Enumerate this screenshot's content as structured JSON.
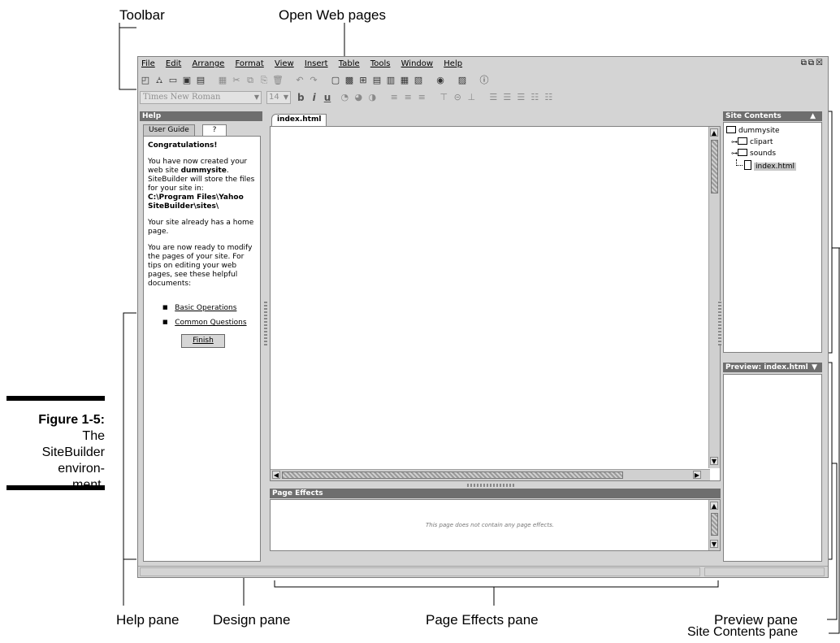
{
  "callouts": {
    "toolbar": "Toolbar",
    "open_pages": "Open Web pages",
    "help_pane": "Help pane",
    "design_pane": "Design pane",
    "page_effects_pane": "Page Effects pane",
    "preview_pane": "Preview pane",
    "site_contents_pane": "Site Contents pane"
  },
  "caption": {
    "label": "Figure 1-5:",
    "line1": "The",
    "line2": "SiteBuilder",
    "line3": "environ-",
    "line4": "ment."
  },
  "menu": [
    "File",
    "Edit",
    "Arrange",
    "Format",
    "View",
    "Insert",
    "Table",
    "Tools",
    "Window",
    "Help"
  ],
  "font_name": "Times New Roman",
  "font_size": "14",
  "format_buttons": [
    "b",
    "i",
    "u"
  ],
  "help": {
    "title": "Help",
    "tab_user_guide": "User Guide",
    "tab_icon": "?",
    "heading": "Congratulations!",
    "p1_a": "You have now created your web site ",
    "p1_site": "dummysite",
    "p1_b": ". SiteBuilder will store the files for your site in:",
    "p1_path": "C:\\Program Files\\Yahoo SiteBuilder\\sites\\",
    "p2": "Your site already has a home page.",
    "p3": "You are now ready to modify the pages of your site. For tips on editing your web pages, see these helpful documents:",
    "link1": "Basic Operations",
    "link2": "Common Questions",
    "finish": "Finish"
  },
  "design": {
    "tab": "index.html"
  },
  "page_effects": {
    "title": "Page Effects",
    "empty_message": "This page does not contain any page effects."
  },
  "site_contents": {
    "title": "Site Contents",
    "collapse_glyph": "▲",
    "root": "dummysite",
    "folders": [
      "clipart",
      "sounds"
    ],
    "file": "index.html"
  },
  "preview": {
    "title": "Preview: index.html",
    "dropdown_glyph": "▼"
  }
}
